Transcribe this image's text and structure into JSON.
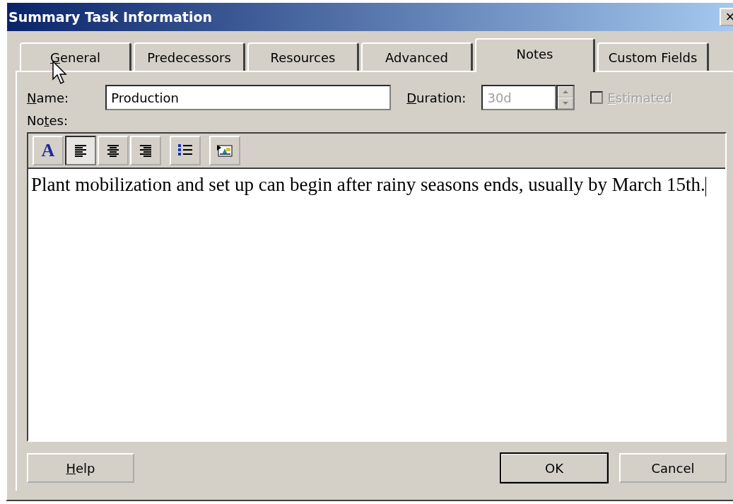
{
  "window": {
    "title": "Summary Task Information",
    "close_glyph": "×"
  },
  "tabs": [
    {
      "label": {
        "key": "G",
        "post": "eneral"
      },
      "selected": false
    },
    {
      "label": {
        "post": "Predecessors"
      },
      "selected": false
    },
    {
      "label": {
        "post": "Resources"
      },
      "selected": false
    },
    {
      "label": {
        "post": "Advanced"
      },
      "selected": false
    },
    {
      "label": {
        "post": "Notes"
      },
      "selected": true
    },
    {
      "label": {
        "post": "Custom Fields"
      },
      "selected": false
    }
  ],
  "name": {
    "label": {
      "key": "N",
      "post": "ame:"
    },
    "value": "Production"
  },
  "duration": {
    "label": {
      "key": "D",
      "post": "uration:"
    },
    "value": "30d",
    "disabled": true
  },
  "estimated": {
    "label": {
      "key": "E",
      "post": "stimated"
    },
    "checked": false,
    "disabled": true
  },
  "notes": {
    "label": {
      "pre": "No",
      "key": "t",
      "post": "es:"
    },
    "toolbar": [
      {
        "kind": "font",
        "glyph": "A",
        "selected": false
      },
      {
        "kind": "align-left",
        "selected": true
      },
      {
        "kind": "align-center",
        "selected": false
      },
      {
        "kind": "align-right",
        "selected": false
      },
      {
        "kind": "bullets",
        "selected": false
      },
      {
        "kind": "object",
        "selected": false
      }
    ],
    "text": "Plant mobilization and set up can begin after rainy seasons ends, usually by March 15th."
  },
  "buttons": [
    {
      "kind": "help",
      "label": {
        "key": "H",
        "post": "elp"
      }
    },
    {
      "kind": "ok",
      "label": {
        "post": "OK"
      }
    },
    {
      "kind": "cancel",
      "label": {
        "post": "Cancel"
      }
    }
  ]
}
